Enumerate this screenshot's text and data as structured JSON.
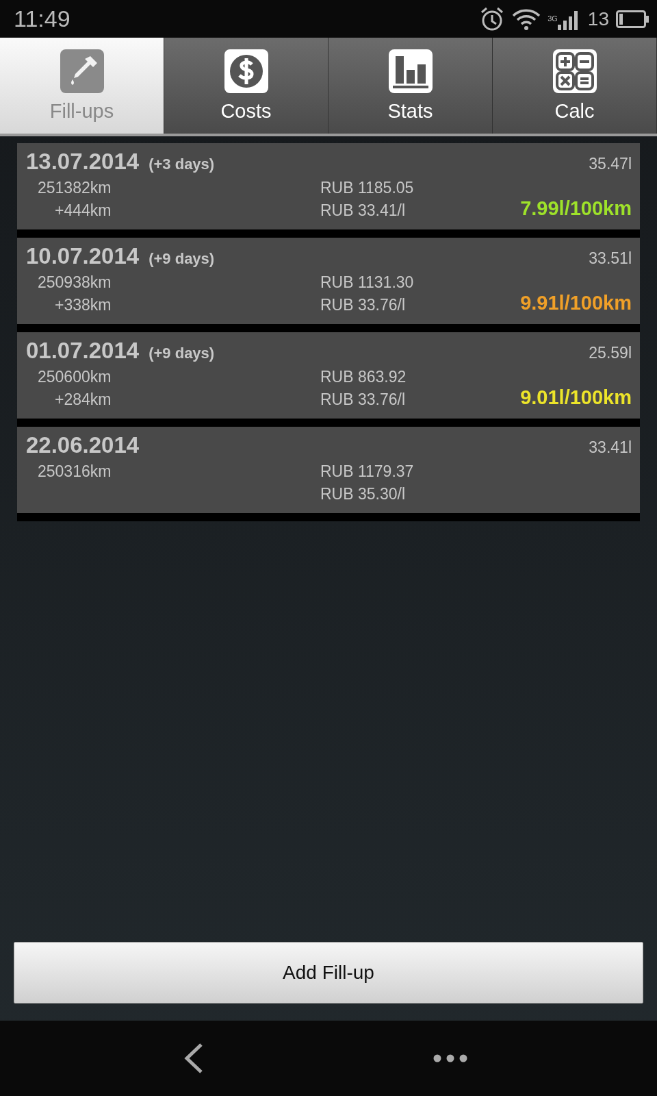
{
  "status_bar": {
    "time": "11:49",
    "network": "3G",
    "battery": "13"
  },
  "tabs": [
    {
      "label": "Fill-ups",
      "kind": "dropper",
      "selected": true
    },
    {
      "label": "Costs",
      "kind": "dollar",
      "selected": false
    },
    {
      "label": "Stats",
      "kind": "chart",
      "selected": false
    },
    {
      "label": "Calc",
      "kind": "calc",
      "selected": false
    }
  ],
  "fillups": [
    {
      "date": "13.07.2014",
      "interval": "(+3 days)",
      "volume": "35.47l",
      "odometer": "251382km",
      "distance": "+444km",
      "cost": "RUB 1185.05",
      "price": "RUB 33.41/l",
      "consumption": "7.99l/100km",
      "color": "#9ee22a"
    },
    {
      "date": "10.07.2014",
      "interval": "(+9 days)",
      "volume": "33.51l",
      "odometer": "250938km",
      "distance": "+338km",
      "cost": "RUB 1131.30",
      "price": "RUB 33.76/l",
      "consumption": "9.91l/100km",
      "color": "#f0a028"
    },
    {
      "date": "01.07.2014",
      "interval": "(+9 days)",
      "volume": "25.59l",
      "odometer": "250600km",
      "distance": "+284km",
      "cost": "RUB 863.92",
      "price": "RUB 33.76/l",
      "consumption": "9.01l/100km",
      "color": "#ece42a"
    },
    {
      "date": "22.06.2014",
      "volume": "33.41l",
      "odometer": "250316km",
      "cost": "RUB 1179.37",
      "price": "RUB 35.30/l"
    }
  ],
  "add_button": "Add Fill-up"
}
